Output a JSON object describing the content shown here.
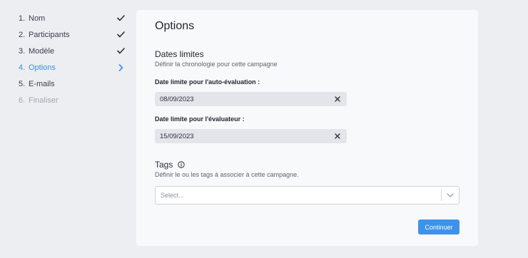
{
  "steps": [
    {
      "num": "1.",
      "label": "Nom",
      "state": "done"
    },
    {
      "num": "2.",
      "label": "Participants",
      "state": "done"
    },
    {
      "num": "3.",
      "label": "Modèle",
      "state": "done"
    },
    {
      "num": "4.",
      "label": "Options",
      "state": "active"
    },
    {
      "num": "5.",
      "label": "E-mails",
      "state": "pending"
    },
    {
      "num": "6.",
      "label": "Finaliser",
      "state": "disabled"
    }
  ],
  "main": {
    "title": "Options",
    "deadlines": {
      "title": "Dates limites",
      "description": "Définir la chronologie pour cette campagne",
      "self_eval_label": "Date limite pour l'auto-évaluation :",
      "self_eval_value": "08/09/2023",
      "evaluator_label": "Date limite pour l'évaluateur :",
      "evaluator_value": "15/09/2023"
    },
    "tags": {
      "title": "Tags",
      "description": "Définir le ou les tags à associer à cette campagne.",
      "placeholder": "Select..."
    },
    "continue_label": "Continuer"
  },
  "colors": {
    "accent": "#3d93ea",
    "active_step": "#3d8fe0",
    "background": "#eceef2",
    "panel": "#f8f9fb"
  }
}
